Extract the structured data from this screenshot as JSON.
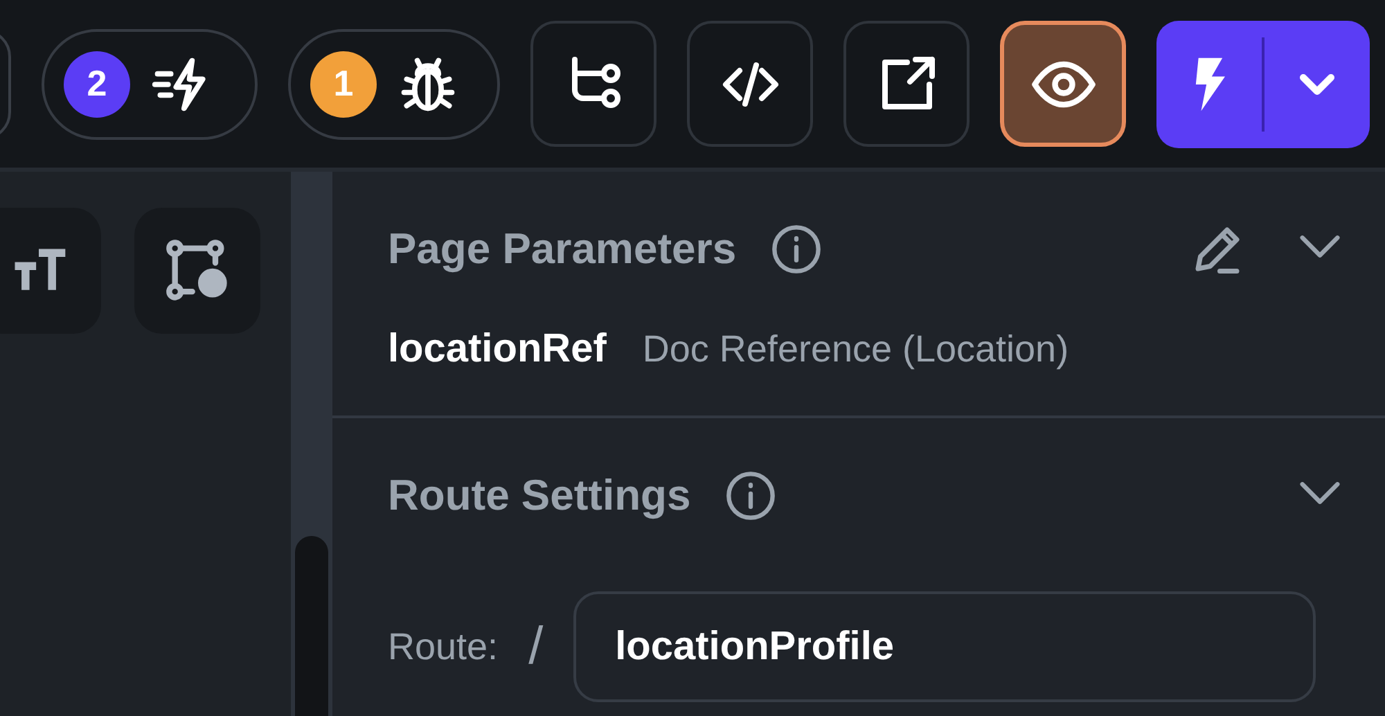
{
  "toolbar": {
    "counters": [
      {
        "count": "2",
        "color": "#5b3df5",
        "kind": "actions"
      },
      {
        "count": "1",
        "color": "#f2a03a",
        "kind": "bugs"
      }
    ],
    "buttons": [
      {
        "kind": "branch",
        "selected": false
      },
      {
        "kind": "code",
        "selected": false
      },
      {
        "kind": "export",
        "selected": false
      },
      {
        "kind": "preview",
        "selected": true
      }
    ]
  },
  "tools": [
    {
      "kind": "text-size"
    },
    {
      "kind": "shape-settings"
    }
  ],
  "page_parameters": {
    "title": "Page Parameters",
    "params": [
      {
        "name": "locationRef",
        "type": "Doc Reference (Location)"
      }
    ]
  },
  "route_settings": {
    "title": "Route Settings",
    "label": "Route:",
    "separator": "/",
    "value": "locationProfile"
  }
}
